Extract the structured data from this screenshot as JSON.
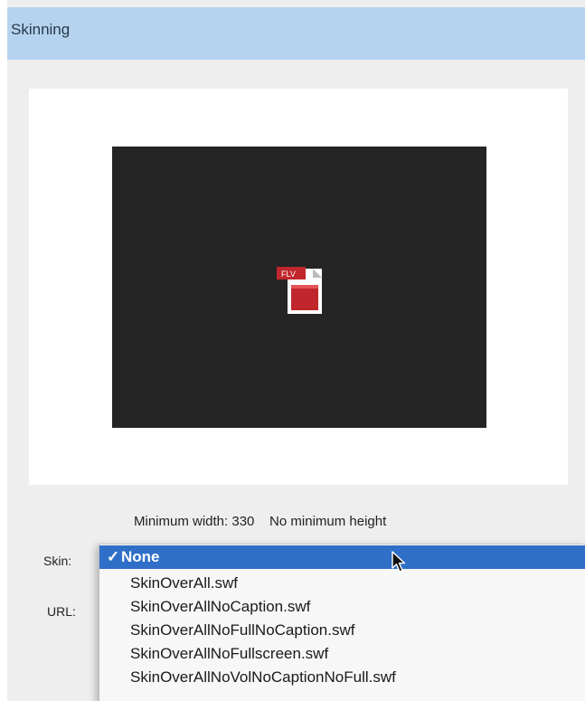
{
  "panel": {
    "title": "Skinning"
  },
  "preview": {
    "icon": "flv-file-icon",
    "icon_badge": "FLV",
    "video_background": "#252525"
  },
  "constraints": {
    "text": "Minimum width: 330    No minimum height"
  },
  "form": {
    "skin_label": "Skin:",
    "url_label": "URL:"
  },
  "skin_menu": {
    "check_mark": "✓",
    "selected_index": 0,
    "accent_color": "#2f6fc7",
    "items": [
      {
        "label": "None"
      },
      {
        "label": "SkinOverAll.swf"
      },
      {
        "label": "SkinOverAllNoCaption.swf"
      },
      {
        "label": "SkinOverAllNoFullNoCaption.swf"
      },
      {
        "label": "SkinOverAllNoFullscreen.swf"
      },
      {
        "label": "SkinOverAllNoVolNoCaptionNoFull.swf"
      }
    ]
  },
  "cursor": "arrow-cursor-icon"
}
